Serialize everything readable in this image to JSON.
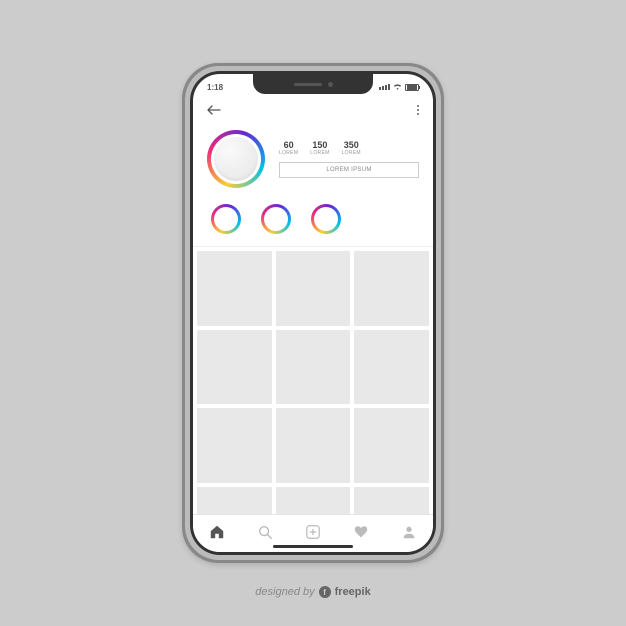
{
  "status": {
    "time": "1:18"
  },
  "profile": {
    "stats": [
      {
        "value": "60",
        "label": "LOREM"
      },
      {
        "value": "150",
        "label": "LOREM"
      },
      {
        "value": "350",
        "label": "LOREM"
      }
    ],
    "action_button": "LOREM IPSUM"
  },
  "highlights_count": 3,
  "grid_count": 12,
  "attribution": {
    "prefix": "designed by",
    "brand": "freepik"
  },
  "colors": {
    "page_bg": "#cccccc",
    "cell": "#e8e8e8",
    "gradient": [
      "#f9ce34",
      "#ee2a7b",
      "#6228d7",
      "#00c2e8"
    ]
  }
}
